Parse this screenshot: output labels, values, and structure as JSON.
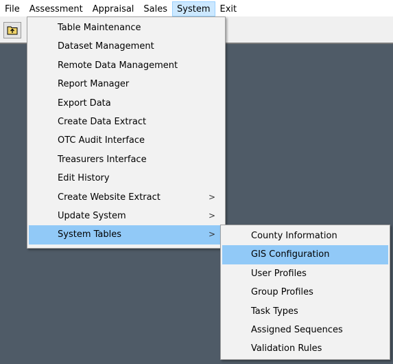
{
  "menubar": {
    "items": [
      {
        "label": "File"
      },
      {
        "label": "Assessment"
      },
      {
        "label": "Appraisal"
      },
      {
        "label": "Sales"
      },
      {
        "label": "System"
      },
      {
        "label": "Exit"
      }
    ]
  },
  "toolbar": {
    "back_icon": "folder-up-icon"
  },
  "system_menu": {
    "items": [
      {
        "label": "Table Maintenance"
      },
      {
        "label": "Dataset Management"
      },
      {
        "label": "Remote Data Management"
      },
      {
        "label": "Report Manager"
      },
      {
        "label": "Export Data"
      },
      {
        "label": "Create Data Extract"
      },
      {
        "label": "OTC Audit Interface"
      },
      {
        "label": "Treasurers Interface"
      },
      {
        "label": "Edit History"
      },
      {
        "label": "Create Website Extract",
        "submenu_arrow": ">"
      },
      {
        "label": "Update System",
        "submenu_arrow": ">"
      },
      {
        "label": "System Tables",
        "submenu_arrow": ">"
      }
    ]
  },
  "system_tables_menu": {
    "items": [
      {
        "label": "County Information"
      },
      {
        "label": "GIS Configuration"
      },
      {
        "label": "User Profiles"
      },
      {
        "label": "Group Profiles"
      },
      {
        "label": "Task Types"
      },
      {
        "label": "Assigned Sequences"
      },
      {
        "label": "Validation Rules"
      }
    ]
  },
  "colors": {
    "workspace": "#4f5b67",
    "menu_highlight": "#91c9f7",
    "menubar_active": "#cce8ff"
  }
}
